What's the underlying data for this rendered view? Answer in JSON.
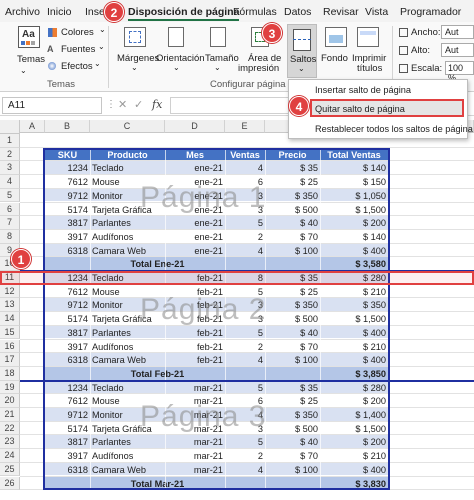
{
  "menu": {
    "items": [
      "Archivo",
      "Inicio",
      "Inse",
      "Disposición de página",
      "Fórmulas",
      "Datos",
      "Revisar",
      "Vista",
      "Programador"
    ]
  },
  "ribbon": {
    "temas": {
      "label": "Temas",
      "colores": "Colores",
      "fuentes": "Fuentes",
      "efectos": "Efectos",
      "group": "Temas"
    },
    "config": {
      "margenes": "Márgenes",
      "orientacion": "Orientación",
      "tamano": "Tamaño",
      "area_line1": "Área de",
      "area_line2": "impresión",
      "saltos": "Saltos",
      "fondo": "Fondo",
      "imprimir_line1": "Imprimir",
      "imprimir_line2": "títulos",
      "group": "Configurar página"
    },
    "ajustar": {
      "ancho": "Ancho:",
      "ancho_value": "Aut",
      "alto": "Alto:",
      "alto_value": "Aut",
      "escala": "Escala:",
      "escala_value": "100 %"
    }
  },
  "formula_bar": {
    "name_box": "A11",
    "fx": "fx"
  },
  "dropdown": {
    "items": [
      "Insertar salto de página",
      "Quitar salto de página",
      "Restablecer todos los saltos de página"
    ]
  },
  "badges": [
    "1",
    "2",
    "3",
    "4"
  ],
  "columns": [
    "A",
    "B",
    "C",
    "D",
    "E",
    "F",
    "G"
  ],
  "table": {
    "headers": [
      "SKU",
      "Producto",
      "Mes",
      "Ventas",
      "Precio",
      "Total Ventas"
    ],
    "rows": [
      {
        "n": "1",
        "cells": [
          "",
          "",
          "",
          "",
          "",
          ""
        ],
        "type": "blank"
      },
      {
        "n": "2",
        "cells": [
          "SKU",
          "Producto",
          "Mes",
          "Ventas",
          "Precio",
          "Total Ventas"
        ],
        "type": "header"
      },
      {
        "n": "3",
        "cells": [
          "1234",
          "Teclado",
          "ene-21",
          "4",
          "$ 35",
          "$ 140"
        ],
        "type": "data"
      },
      {
        "n": "4",
        "cells": [
          "7612",
          "Mouse",
          "ene-21",
          "6",
          "$ 25",
          "$ 150"
        ],
        "type": "data"
      },
      {
        "n": "5",
        "cells": [
          "9712",
          "Monitor",
          "ene-21",
          "3",
          "$ 350",
          "$ 1,050"
        ],
        "type": "data"
      },
      {
        "n": "6",
        "cells": [
          "5174",
          "Tarjeta Gráfica",
          "ene-21",
          "3",
          "$ 500",
          "$ 1,500"
        ],
        "type": "data"
      },
      {
        "n": "7",
        "cells": [
          "3817",
          "Parlantes",
          "ene-21",
          "5",
          "$ 40",
          "$ 200"
        ],
        "type": "data"
      },
      {
        "n": "8",
        "cells": [
          "3917",
          "Audífonos",
          "ene-21",
          "2",
          "$ 70",
          "$ 140"
        ],
        "type": "data"
      },
      {
        "n": "9",
        "cells": [
          "6318",
          "Camara Web",
          "ene-21",
          "4",
          "$ 100",
          "$ 400"
        ],
        "type": "data"
      },
      {
        "n": "10",
        "cells": [
          "",
          "",
          "Total Ene-21",
          "",
          "",
          "$ 3,580"
        ],
        "type": "total"
      },
      {
        "n": "11",
        "cells": [
          "1234",
          "Teclado",
          "feb-21",
          "8",
          "$ 35",
          "$ 280"
        ],
        "type": "data"
      },
      {
        "n": "12",
        "cells": [
          "7612",
          "Mouse",
          "feb-21",
          "5",
          "$ 25",
          "$ 210"
        ],
        "type": "data"
      },
      {
        "n": "13",
        "cells": [
          "9712",
          "Monitor",
          "feb-21",
          "3",
          "$ 350",
          "$ 350"
        ],
        "type": "data"
      },
      {
        "n": "14",
        "cells": [
          "5174",
          "Tarjeta Gráfica",
          "feb-21",
          "3",
          "$ 500",
          "$ 1,500"
        ],
        "type": "data"
      },
      {
        "n": "15",
        "cells": [
          "3817",
          "Parlantes",
          "feb-21",
          "5",
          "$ 40",
          "$ 400"
        ],
        "type": "data"
      },
      {
        "n": "16",
        "cells": [
          "3917",
          "Audífonos",
          "feb-21",
          "2",
          "$ 70",
          "$ 210"
        ],
        "type": "data"
      },
      {
        "n": "17",
        "cells": [
          "6318",
          "Camara Web",
          "feb-21",
          "4",
          "$ 100",
          "$ 400"
        ],
        "type": "data"
      },
      {
        "n": "18",
        "cells": [
          "",
          "",
          "Total Feb-21",
          "",
          "",
          "$ 3,850"
        ],
        "type": "total"
      },
      {
        "n": "19",
        "cells": [
          "1234",
          "Teclado",
          "mar-21",
          "5",
          "$ 35",
          "$ 280"
        ],
        "type": "data"
      },
      {
        "n": "20",
        "cells": [
          "7612",
          "Mouse",
          "mar-21",
          "6",
          "$ 25",
          "$ 200"
        ],
        "type": "data"
      },
      {
        "n": "21",
        "cells": [
          "9712",
          "Monitor",
          "mar-21",
          "4",
          "$ 350",
          "$ 1,400"
        ],
        "type": "data"
      },
      {
        "n": "22",
        "cells": [
          "5174",
          "Tarjeta Gráfica",
          "mar-21",
          "3",
          "$ 500",
          "$ 1,500"
        ],
        "type": "data"
      },
      {
        "n": "23",
        "cells": [
          "3817",
          "Parlantes",
          "mar-21",
          "5",
          "$ 40",
          "$ 200"
        ],
        "type": "data"
      },
      {
        "n": "24",
        "cells": [
          "3917",
          "Audífonos",
          "mar-21",
          "2",
          "$ 70",
          "$ 210"
        ],
        "type": "data"
      },
      {
        "n": "25",
        "cells": [
          "6318",
          "Camara Web",
          "mar-21",
          "4",
          "$ 100",
          "$ 400"
        ],
        "type": "data"
      },
      {
        "n": "26",
        "cells": [
          "",
          "",
          "Total Mar-21",
          "",
          "",
          "$ 3,830"
        ],
        "type": "total"
      }
    ]
  },
  "watermarks": [
    "Página 1",
    "Página 2",
    "Página 3"
  ],
  "colors": {
    "header_blue": "#4472c4",
    "band_light": "#d9e1f2",
    "total_blue": "#b4c6e7",
    "page_border": "#1f2fa0",
    "highlight_red": "#e04040",
    "excel_green": "#217346"
  }
}
